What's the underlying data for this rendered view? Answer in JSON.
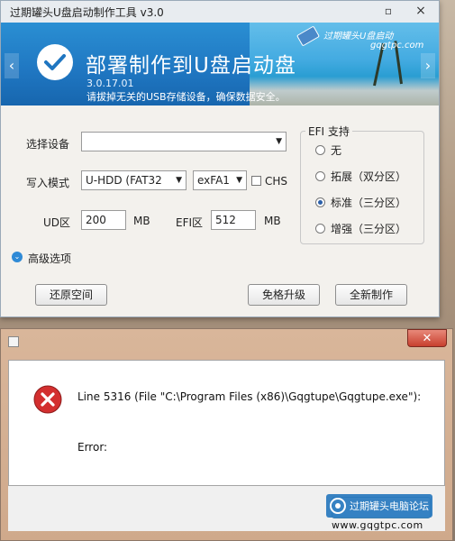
{
  "app": {
    "title": "过期罐头U盘启动制作工具 v3.0",
    "minimize_icon": "▫",
    "close_icon": "×"
  },
  "banner": {
    "heading": "部署制作到U盘启动盘",
    "version": "3.0.17.01",
    "warning": "请拔掉无关的USB存储设备，确保数据安全。",
    "brand_cn": "过期罐头U盘启动",
    "brand_url": "gqgtpc.com",
    "prev_icon": "‹",
    "next_icon": "›"
  },
  "form": {
    "device_label": "选择设备",
    "device_value": "",
    "write_mode_label": "写入模式",
    "write_mode_value": "U-HDD (FAT32",
    "fs_value": "exFA1",
    "chs_label": "CHS",
    "ud_label": "UD区",
    "ud_value": "200",
    "ud_unit": "MB",
    "efi_part_label": "EFI区",
    "efi_part_value": "512",
    "efi_unit": "MB",
    "dropdown_arrow": "▼"
  },
  "efi": {
    "legend": "EFI 支持",
    "options": [
      {
        "label": "无"
      },
      {
        "label": "拓展（双分区）"
      },
      {
        "label": "标准（三分区）"
      },
      {
        "label": "增强（三分区）"
      }
    ],
    "selected_index": 2
  },
  "advanced": {
    "label": "高级选项",
    "icon": "⌄"
  },
  "buttons": {
    "restore": "还原空间",
    "upgrade": "免格升级",
    "new_make": "全新制作"
  },
  "dialog": {
    "close_icon": "✕",
    "message": "Line 5316  (File \"C:\\Program Files (x86)\\Gqgtupe\\Gqgtupe.exe\"):",
    "error_label": "Error:"
  },
  "watermark": {
    "text": "过期罐头电脑论坛",
    "url": "www.gqgtpc.com"
  },
  "colors": {
    "banner_blue": "#1f76c1",
    "error_red": "#d32f2f",
    "close_red": "#c8402e"
  }
}
